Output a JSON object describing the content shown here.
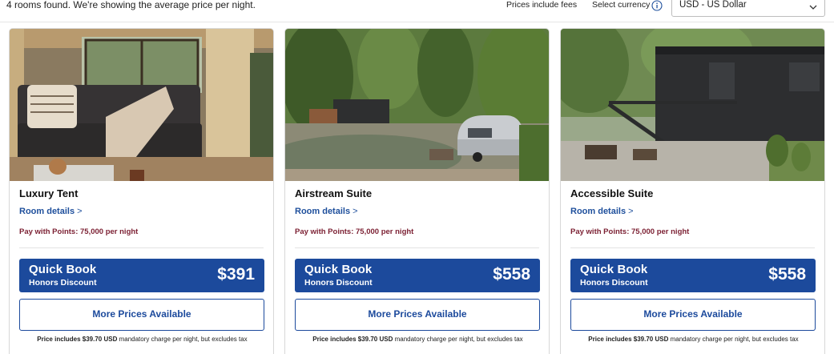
{
  "header": {
    "rooms_found": "4 rooms found. We're showing the average price per night.",
    "prices_include_fees": "Prices include fees",
    "select_currency_label": "Select currency",
    "currency_value": "USD - US Dollar"
  },
  "icons": {
    "info": "info-circle-icon",
    "chevron": "chevron-down-icon"
  },
  "colors": {
    "brand_blue": "#1c4a9c",
    "points_text": "#7b1f32",
    "link_blue": "#1e4f9c"
  },
  "cards": [
    {
      "name": "Luxury Tent",
      "details_label": "Room details",
      "details_arrow": ">",
      "points": "Pay with Points: 75,000 per night",
      "quick_book": "Quick Book",
      "discount": "Honors Discount",
      "price": "$391",
      "more_prices": "More Prices Available",
      "fine_bold": "Price includes $39.70 USD",
      "fine_rest": " mandatory charge per night, but excludes tax"
    },
    {
      "name": "Airstream Suite",
      "details_label": "Room details",
      "details_arrow": ">",
      "points": "Pay with Points: 75,000 per night",
      "quick_book": "Quick Book",
      "discount": "Honors Discount",
      "price": "$558",
      "more_prices": "More Prices Available",
      "fine_bold": "Price includes $39.70 USD",
      "fine_rest": " mandatory charge per night, but excludes tax"
    },
    {
      "name": "Accessible Suite",
      "details_label": "Room details",
      "details_arrow": ">",
      "points": "Pay with Points: 75,000 per night",
      "quick_book": "Quick Book",
      "discount": "Honors Discount",
      "price": "$558",
      "more_prices": "More Prices Available",
      "fine_bold": "Price includes $39.70 USD",
      "fine_rest": " mandatory charge per night, but excludes tax"
    }
  ]
}
